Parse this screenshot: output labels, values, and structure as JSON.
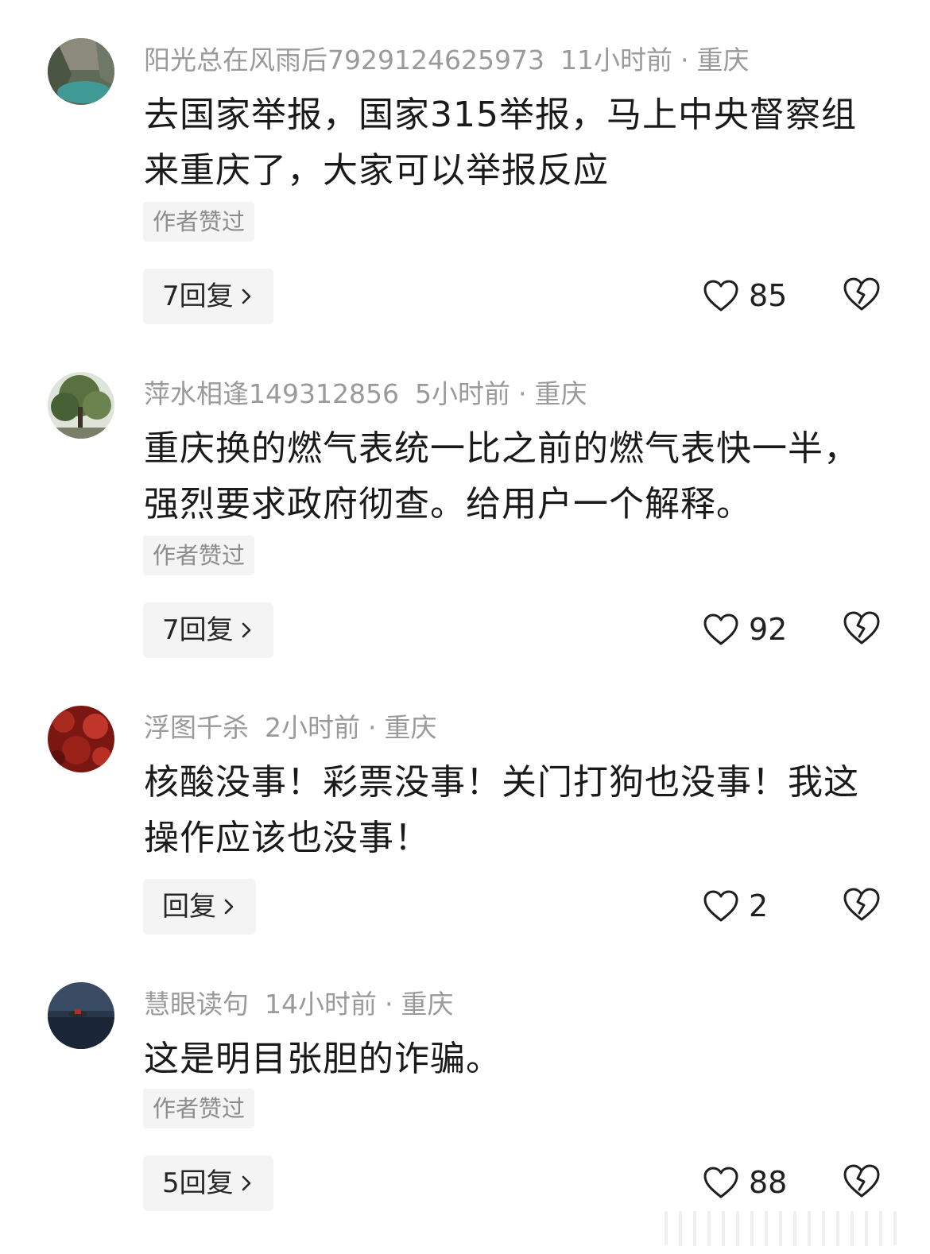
{
  "comments": [
    {
      "username": "阳光总在风雨后7929124625973",
      "time": "11小时前",
      "location": "重庆",
      "text": "去国家举报，国家315举报，马上中央督察组来重庆了，大家可以举报反应",
      "badge": "作者赞过",
      "reply_label": "7回复",
      "likes": "85",
      "avatar_colors": [
        "#5e6b58",
        "#7fa9a3",
        "#3d8d8a"
      ]
    },
    {
      "username": "萍水相逢149312856",
      "time": "5小时前",
      "location": "重庆",
      "text": "重庆换的燃气表统一比之前的燃气表快一半，强烈要求政府彻查。给用户一个解释。",
      "badge": "作者赞过",
      "reply_label": "7回复",
      "likes": "92",
      "avatar_colors": [
        "#d9dfd6",
        "#5a7343",
        "#2f4a2a"
      ]
    },
    {
      "username": "浮图千杀",
      "time": "2小时前",
      "location": "重庆",
      "text": "核酸没事！彩票没事！关门打狗也没事！我这操作应该也没事！",
      "badge": "",
      "reply_label": "回复",
      "likes": "2",
      "avatar_colors": [
        "#6e1410",
        "#b3261d",
        "#8a1b14"
      ]
    },
    {
      "username": "慧眼读句",
      "time": "14小时前",
      "location": "重庆",
      "text": "这是明目张胆的诈骗。",
      "badge": "作者赞过",
      "reply_label": "5回复",
      "likes": "88",
      "avatar_colors": [
        "#1c2838",
        "#3c4f66",
        "#b0302a"
      ]
    }
  ],
  "separator": "·",
  "icons": {
    "like": "heart-outline-icon",
    "dislike": "broken-heart-icon",
    "reply": "chevron-right-icon"
  }
}
